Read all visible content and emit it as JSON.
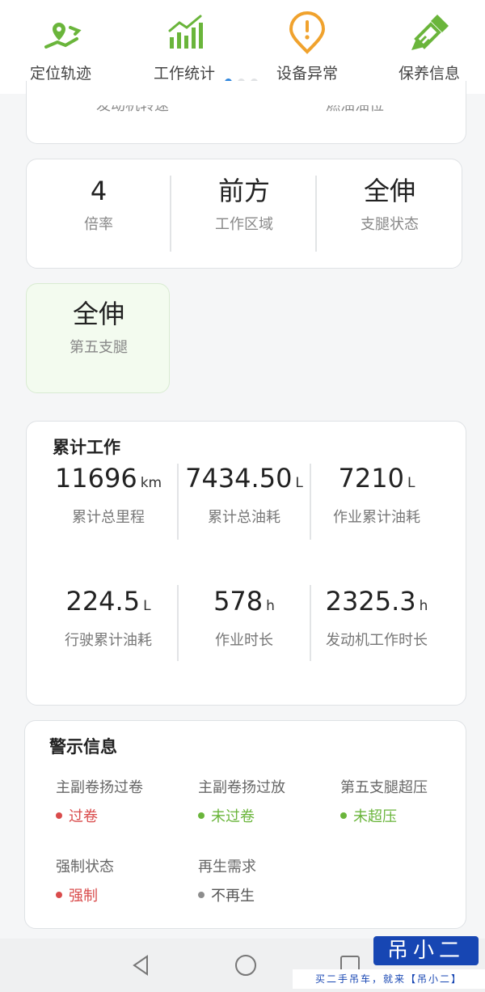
{
  "colors": {
    "accent_green": "#6ab53b",
    "accent_orange": "#f0a22d",
    "active_dot": "#2f86dd",
    "status_red": "#d94b4b",
    "status_green": "#6ab53b",
    "status_grey": "#8d8d8d",
    "watermark_blue": "#1746b3"
  },
  "top_nav": {
    "items": [
      {
        "label": "定位轨迹",
        "icon": "map-location-icon"
      },
      {
        "label": "工作统计",
        "icon": "stats-chart-icon"
      },
      {
        "label": "设备异常",
        "icon": "warning-icon"
      },
      {
        "label": "保养信息",
        "icon": "maintenance-brush-icon"
      }
    ]
  },
  "partial_card": {
    "left_text": "发动机转速",
    "right_text": "燃油油位"
  },
  "status": {
    "items": [
      {
        "value": "4",
        "label": "倍率"
      },
      {
        "value": "前方",
        "label": "工作区域"
      },
      {
        "value": "全伸",
        "label": "支腿状态"
      }
    ],
    "fifth_leg": {
      "value": "全伸",
      "label": "第五支腿"
    }
  },
  "cumulative": {
    "title": "累计工作",
    "metrics": [
      {
        "value": "11696",
        "unit": "km",
        "label": "累计总里程"
      },
      {
        "value": "7434.50",
        "unit": "L",
        "label": "累计总油耗"
      },
      {
        "value": "7210",
        "unit": "L",
        "label": "作业累计油耗"
      },
      {
        "value": "224.5",
        "unit": "L",
        "label": "行驶累计油耗"
      },
      {
        "value": "578",
        "unit": "h",
        "label": "作业时长"
      },
      {
        "value": "2325.3",
        "unit": "h",
        "label": "发动机工作时长"
      }
    ]
  },
  "warnings": {
    "title": "警示信息",
    "items": [
      {
        "label": "主副卷扬过卷",
        "status": "过卷",
        "color": "#d94b4b"
      },
      {
        "label": "主副卷扬过放",
        "status": "未过卷",
        "color": "#6ab53b"
      },
      {
        "label": "第五支腿超压",
        "status": "未超压",
        "color": "#6ab53b"
      },
      {
        "label": "强制状态",
        "status": "强制",
        "color": "#d94b4b"
      },
      {
        "label": "再生需求",
        "status": "不再生",
        "color": "#8d8d8d"
      }
    ]
  },
  "watermark": {
    "brand": "吊小二",
    "slogan": "买二手吊车，就来【吊小二】"
  }
}
